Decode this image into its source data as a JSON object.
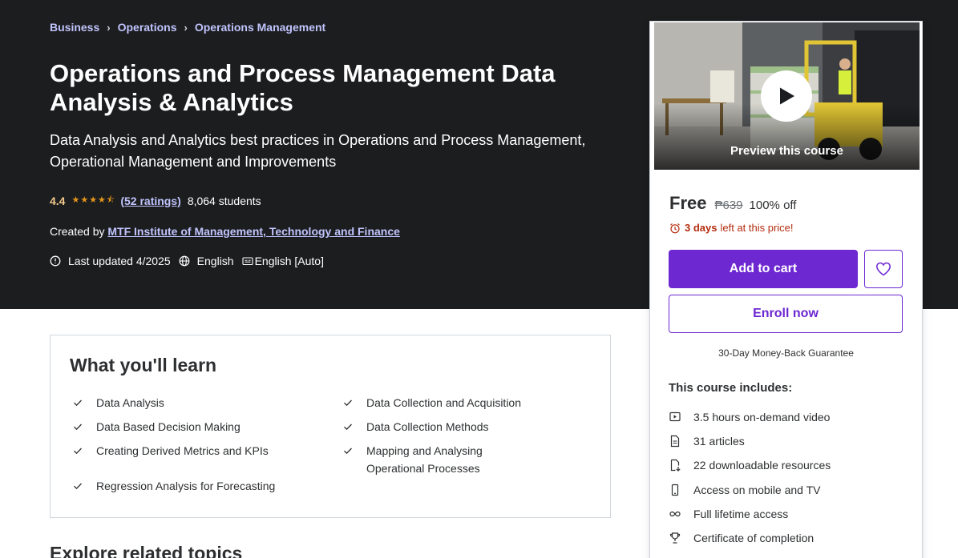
{
  "breadcrumb": [
    "Business",
    "Operations",
    "Operations Management"
  ],
  "course": {
    "title": "Operations and Process Management Data Analysis & Analytics",
    "subtitle": "Data Analysis and Analytics best practices in Operations and Process Management, Operational Management and Improvements",
    "rating": "4.4",
    "stars": 4.5,
    "ratings_link": "(52 ratings)",
    "students": "8,064 students",
    "created_by_label": "Created by",
    "author": "MTF Institute of Management, Technology and Finance",
    "last_updated": "Last updated 4/2025",
    "language": "English",
    "captions": "English [Auto]"
  },
  "card": {
    "preview_label": "Preview this course",
    "price": "Free",
    "original_price": "₱639",
    "discount": "100% off",
    "timer_bold": "3 days",
    "timer_rest": "left at this price!",
    "add_to_cart": "Add to cart",
    "enroll_now": "Enroll now",
    "guarantee": "30-Day Money-Back Guarantee",
    "includes_title": "This course includes:",
    "includes": [
      {
        "icon": "video-icon",
        "text": "3.5 hours on-demand video"
      },
      {
        "icon": "article-icon",
        "text": "31 articles"
      },
      {
        "icon": "download-icon",
        "text": "22 downloadable resources"
      },
      {
        "icon": "mobile-icon",
        "text": "Access on mobile and TV"
      },
      {
        "icon": "infinity-icon",
        "text": "Full lifetime access"
      },
      {
        "icon": "trophy-icon",
        "text": "Certificate of completion"
      }
    ]
  },
  "learn": {
    "title": "What you'll learn",
    "left": [
      "Data Analysis",
      "Data Based Decision Making",
      "Creating Derived Metrics and KPIs",
      "Regression Analysis for Forecasting"
    ],
    "right": [
      "Data Collection and Acquisition",
      "Data Collection Methods",
      "Mapping and Analysing Operational Processes"
    ]
  },
  "explore_title": "Explore related topics",
  "colors": {
    "hero_bg": "#1c1d1f",
    "accent": "#6d28d2",
    "link_light": "#c0c4fc",
    "star": "#e59819",
    "timer": "#b32d0f"
  }
}
